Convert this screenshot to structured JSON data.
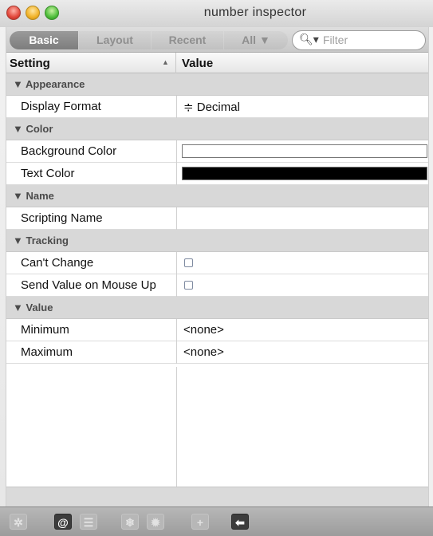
{
  "window": {
    "title": "number inspector"
  },
  "tabs": [
    {
      "label": "Basic",
      "selected": true
    },
    {
      "label": "Layout"
    },
    {
      "label": "Recent"
    },
    {
      "label": "All ▼"
    }
  ],
  "filter": {
    "placeholder": "Filter",
    "icon": "search-icon"
  },
  "columns": {
    "setting": "Setting",
    "value": "Value",
    "sort": "▲"
  },
  "sections": {
    "appearance": {
      "title": "▼ Appearance",
      "display_format": {
        "label": "Display Format",
        "value": "≑ Decimal"
      }
    },
    "color": {
      "title": "▼ Color",
      "background_color": {
        "label": "Background Color",
        "color": "#ffffff"
      },
      "text_color": {
        "label": "Text Color",
        "color": "#000000"
      }
    },
    "name": {
      "title": "▼ Name",
      "scripting_name": {
        "label": "Scripting Name",
        "value": ""
      }
    },
    "tracking": {
      "title": "▼ Tracking",
      "cant_change": {
        "label": "Can't Change",
        "checked": false
      },
      "send_value": {
        "label": "Send Value on Mouse Up",
        "checked": false
      }
    },
    "value": {
      "title": "▼ Value",
      "minimum": {
        "label": "Minimum",
        "value": "<none>"
      },
      "maximum": {
        "label": "Maximum",
        "value": "<none>"
      }
    }
  },
  "toolbar": {
    "buttons": [
      {
        "icon": "gear-icon",
        "glyph": "✲"
      },
      {
        "icon": "at-sign-icon",
        "glyph": "@"
      },
      {
        "icon": "list-icon",
        "glyph": "☰"
      },
      {
        "icon": "snowflake-icon",
        "glyph": "❄"
      },
      {
        "icon": "badge-icon",
        "glyph": "✹"
      },
      {
        "icon": "add-icon",
        "glyph": "+"
      },
      {
        "icon": "back-arrow-icon",
        "glyph": "⬅"
      }
    ]
  }
}
